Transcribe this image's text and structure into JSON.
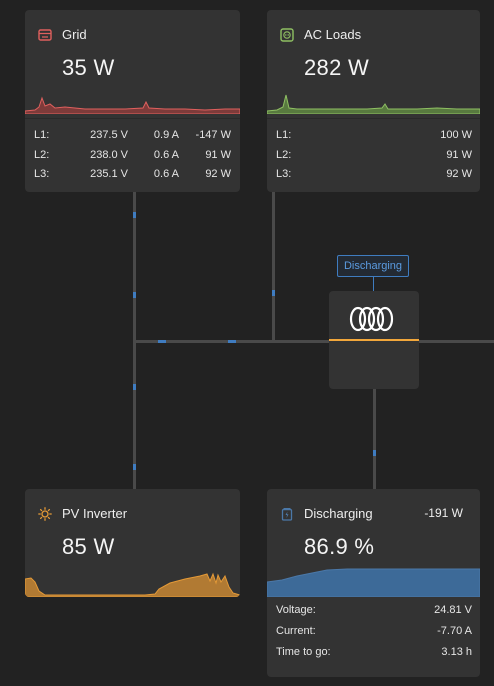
{
  "colors": {
    "background": "#222222",
    "card": "#333333",
    "grid_accent": "#e0605e",
    "ac_accent": "#8fc063",
    "pv_accent": "#e59a37",
    "battery_accent": "#4b78a8",
    "wire": "#4a4a4a",
    "flow_dot": "#3f7cc0",
    "inverter_line": "#f2a73b"
  },
  "grid": {
    "icon": "grid-meter-icon",
    "title": "Grid",
    "power": "35 W",
    "phases": [
      {
        "label": "L1:",
        "voltage": "237.5 V",
        "current": "0.9 A",
        "power": "-147 W"
      },
      {
        "label": "L2:",
        "voltage": "238.0 V",
        "current": "0.6 A",
        "power": "91 W"
      },
      {
        "label": "L3:",
        "voltage": "235.1 V",
        "current": "0.6 A",
        "power": "92 W"
      }
    ]
  },
  "ac_loads": {
    "icon": "socket-icon",
    "title": "AC Loads",
    "power": "282 W",
    "phases": [
      {
        "label": "L1:",
        "power": "100 W"
      },
      {
        "label": "L2:",
        "power": "91 W"
      },
      {
        "label": "L3:",
        "power": "92 W"
      }
    ]
  },
  "inverter": {
    "icon": "inverter-logo-icon",
    "status_badge": "Discharging"
  },
  "pv_inverter": {
    "icon": "sun-icon",
    "title": "PV Inverter",
    "power": "85 W"
  },
  "battery": {
    "icon": "battery-icon",
    "title": "Discharging",
    "power": "-191 W",
    "soc": "86.9 %",
    "stats": [
      {
        "label": "Voltage:",
        "value": "24.81 V"
      },
      {
        "label": "Current:",
        "value": "-7.70 A"
      },
      {
        "label": "Time to go:",
        "value": "3.13 h"
      }
    ]
  }
}
